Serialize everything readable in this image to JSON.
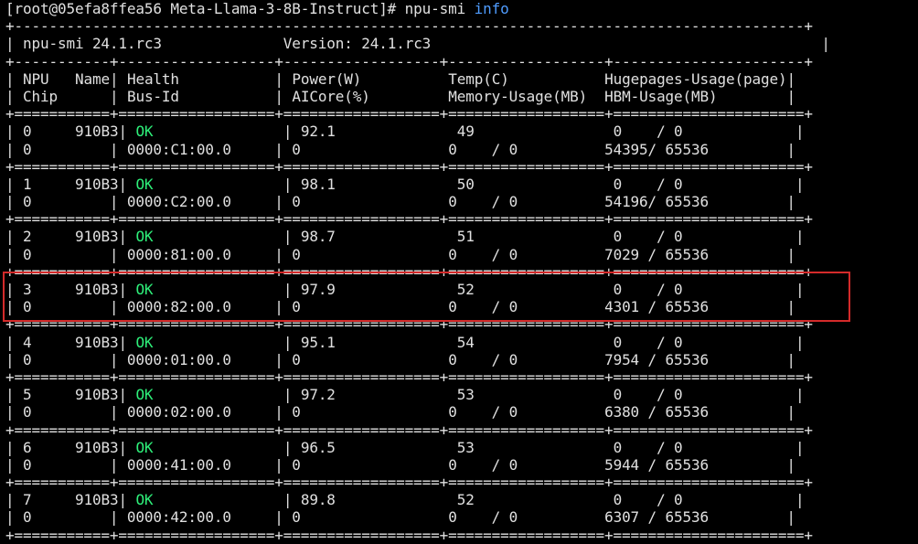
{
  "terminal": {
    "prompt": "[root@05efa8ffea56 Meta-Llama-3-8B-Instruct]# ",
    "command": "npu-smi",
    "argument": "info",
    "border": "+------------------------------------------------------------------------------------------------+",
    "table_width": 94,
    "info": {
      "tool": "npu-smi 24.1.rc3",
      "version": "Version: 24.1.rc3"
    },
    "headers": [
      [
        "NPU",
        "Name",
        "Health",
        "Power(W)",
        "Temp(C)",
        "Hugepages-Usage(page)"
      ],
      [
        "Chip",
        "",
        "Bus-Id",
        "AICore(%)",
        "Memory-Usage(MB)",
        "HBM-Usage(MB)"
      ]
    ],
    "rows": [
      {
        "npu": "0",
        "name": "910B3",
        "health": "OK",
        "power": "92.1",
        "temp": "49",
        "hugepages": "0    / 0",
        "chip": "0",
        "bus_id": "0000:C1:00.0",
        "aicore": "0",
        "memory": "0    / 0",
        "hbm": "54395/ 65536"
      },
      {
        "npu": "1",
        "name": "910B3",
        "health": "OK",
        "power": "98.1",
        "temp": "50",
        "hugepages": "0    / 0",
        "chip": "0",
        "bus_id": "0000:C2:00.0",
        "aicore": "0",
        "memory": "0    / 0",
        "hbm": "54196/ 65536"
      },
      {
        "npu": "2",
        "name": "910B3",
        "health": "OK",
        "power": "98.7",
        "temp": "51",
        "hugepages": "0    / 0",
        "chip": "0",
        "bus_id": "0000:81:00.0",
        "aicore": "0",
        "memory": "0    / 0",
        "hbm": "7029 / 65536"
      },
      {
        "npu": "3",
        "name": "910B3",
        "health": "OK",
        "power": "97.9",
        "temp": "52",
        "hugepages": "0    / 0",
        "chip": "0",
        "bus_id": "0000:82:00.0",
        "aicore": "0",
        "memory": "0    / 0",
        "hbm": "4301 / 65536"
      },
      {
        "npu": "4",
        "name": "910B3",
        "health": "OK",
        "power": "95.1",
        "temp": "54",
        "hugepages": "0    / 0",
        "chip": "0",
        "bus_id": "0000:01:00.0",
        "aicore": "0",
        "memory": "0    / 0",
        "hbm": "7954 / 65536"
      },
      {
        "npu": "5",
        "name": "910B3",
        "health": "OK",
        "power": "97.2",
        "temp": "53",
        "hugepages": "0    / 0",
        "chip": "0",
        "bus_id": "0000:02:00.0",
        "aicore": "0",
        "memory": "0    / 0",
        "hbm": "6380 / 65536"
      },
      {
        "npu": "6",
        "name": "910B3",
        "health": "OK",
        "power": "96.5",
        "temp": "53",
        "hugepages": "0    / 0",
        "chip": "0",
        "bus_id": "0000:41:00.0",
        "aicore": "0",
        "memory": "0    / 0",
        "hbm": "5944 / 65536"
      },
      {
        "npu": "7",
        "name": "910B3",
        "health": "OK",
        "power": "89.8",
        "temp": "52",
        "hugepages": "0    / 0",
        "chip": "0",
        "bus_id": "0000:42:00.0",
        "aicore": "0",
        "memory": "0    / 0",
        "hbm": "6307 / 65536"
      }
    ],
    "colors": {
      "background": "#000000",
      "text": "#e0e0e0",
      "ok": "#2ef07a",
      "argument": "#4f9cff",
      "highlight": "#d42a2a"
    }
  }
}
